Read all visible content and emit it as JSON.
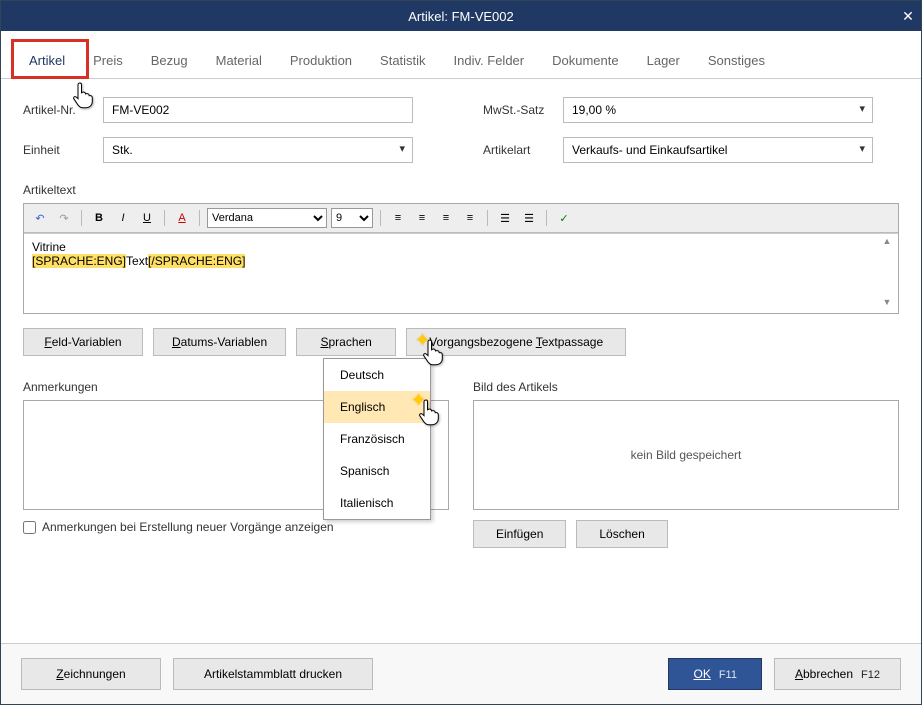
{
  "title": "Artikel: FM-VE002",
  "tabs": [
    "Artikel",
    "Preis",
    "Bezug",
    "Material",
    "Produktion",
    "Statistik",
    "Indiv. Felder",
    "Dokumente",
    "Lager",
    "Sonstiges"
  ],
  "fields": {
    "artikelnr_label": "Artikel-Nr.",
    "artikelnr_value": "FM-VE002",
    "mwst_label": "MwSt.-Satz",
    "mwst_value": "19,00 %",
    "einheit_label": "Einheit",
    "einheit_value": "Stk.",
    "artikelart_label": "Artikelart",
    "artikelart_value": "Verkaufs- und Einkaufsartikel"
  },
  "artikeltext_label": "Artikeltext",
  "editor": {
    "font": "Verdana",
    "size": "9",
    "line1": "Vitrine",
    "tag_open": "[SPRACHE:ENG]",
    "tag_text": "Text",
    "tag_close": "[/SPRACHE:ENG]"
  },
  "buttons": {
    "feld_var": "Feld-Variablen",
    "datum_var": "Datums-Variablen",
    "sprachen": "Sprachen",
    "vorgang": "Vorgangsbezogene Textpassage"
  },
  "lang_menu": [
    "Deutsch",
    "Englisch",
    "Französisch",
    "Spanisch",
    "Italienisch"
  ],
  "anmerkungen_label": "Anmerkungen",
  "bild_label": "Bild des Artikels",
  "bild_empty": "kein Bild gespeichert",
  "checkbox_label": "Anmerkungen bei Erstellung neuer Vorgänge anzeigen",
  "img_btns": {
    "einfuegen": "Einfügen",
    "loeschen": "Löschen"
  },
  "footer": {
    "zeichnungen": "Zeichnungen",
    "stammblatt": "Artikelstammblatt drucken",
    "ok": "OK",
    "ok_key": "F11",
    "abbrechen": "Abbrechen",
    "abbrechen_key": "F12"
  }
}
